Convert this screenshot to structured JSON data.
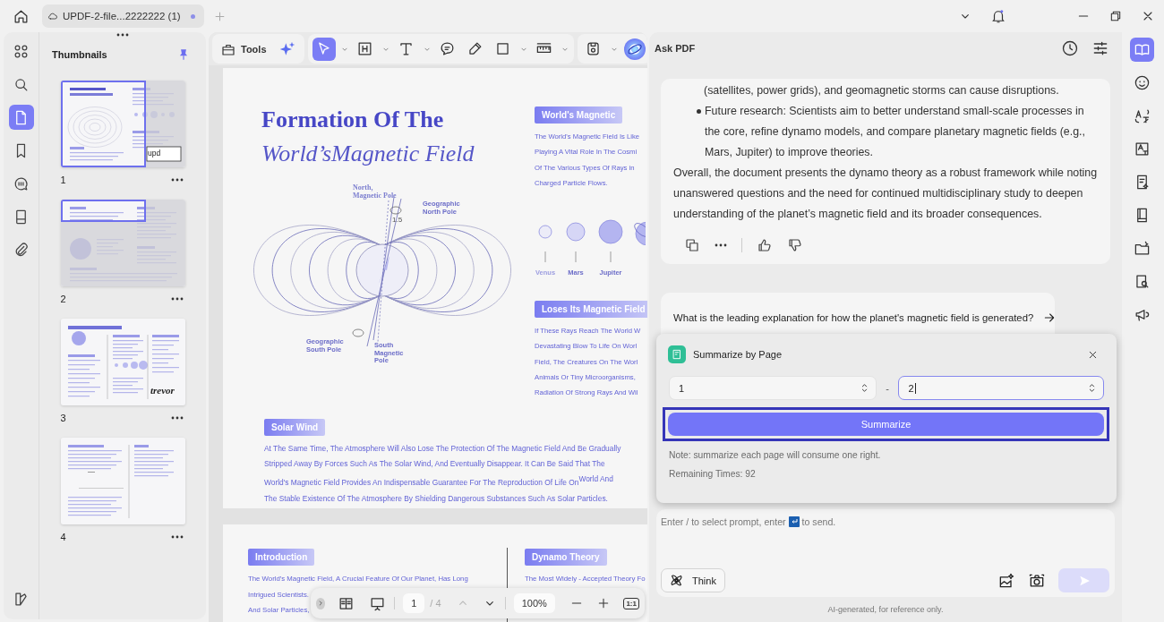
{
  "tab_bar": {
    "tabs": [
      {
        "title": "UPDF-2-file...2222222 (1)",
        "selected": true
      }
    ]
  },
  "left_rail": {
    "items": [
      {
        "selected": false
      },
      {
        "selected": false
      },
      {
        "selected": true
      },
      {
        "selected": false
      },
      {
        "selected": false
      },
      {
        "selected": false
      },
      {
        "selected": false
      },
      {
        "selected": false
      }
    ]
  },
  "thumbnails": {
    "title": "Thumbnails",
    "pages": [
      {
        "number": "1",
        "in_view": true,
        "mark_text": "upd"
      },
      {
        "number": "2",
        "in_view": true
      },
      {
        "number": "3",
        "in_view": false,
        "mark_text": "trevor"
      },
      {
        "number": "4",
        "in_view": false
      }
    ]
  },
  "toolbar": {
    "tools_label": "Tools",
    "tools": [
      {
        "selected": true,
        "menu": true
      },
      {
        "selected": false,
        "menu": true
      },
      {
        "selected": false,
        "menu": true
      },
      {
        "selected": false,
        "menu": false
      },
      {
        "selected": false,
        "menu": false
      },
      {
        "selected": false,
        "menu": true
      },
      {
        "selected": false,
        "menu": true
      }
    ],
    "file_tools": [
      {
        "selected": false,
        "menu": true
      }
    ]
  },
  "page_1": {
    "title": "Formation Of The",
    "subtitle": "World’sMagnetic Field",
    "diagram_labels": [
      {
        "lines": [
          "North,",
          "Magnetic Pole"
        ]
      },
      {
        "lines": [
          "Geographic",
          "North Pole"
        ]
      },
      {
        "lines": [
          "1.5"
        ]
      },
      {
        "lines": [
          "Geographic",
          "South Pole"
        ]
      },
      {
        "lines": [
          "South",
          "Magnetic",
          "Pole"
        ]
      }
    ],
    "sections": [
      {
        "heading": "World's Magnetic",
        "lines": [
          "The World's Magnetic Field Is Like",
          "Playing A Vital Role In The Cosmi",
          "Of The Various Types Of Rays in",
          "Charged Particle Flows."
        ]
      },
      {
        "heading": "Loses Its Magnetic Field",
        "lines": [
          "If These Rays Reach The World W",
          "Devastating Blow To Life On Worl",
          "Field, The Creatures On The Worl",
          "Animals Or Tiny Microorganisms,",
          "Radiation Of Strong Rays And Wil"
        ]
      }
    ],
    "planets": [
      {
        "name": "Venus"
      },
      {
        "name": "Mars"
      },
      {
        "name": "Jupiter"
      }
    ],
    "solar_wind": {
      "heading": "Solar Wind",
      "lines": [
        "At The Same Time, The Atmosphere Will Also Lose The Protection Of The Magnetic Field And Be Gradually",
        "Stripped Away By Forces Such As The Solar Wind, And Eventually Disappear. It Can Be Said That The",
        "World's Magnetic Field Provides An Indispensable Guarantee For The Reproduction Of Life On$^{World And}$",
        "The Stable Existence Of The Atmosphere By Shielding Dangerous Substances Such As Solar Particles."
      ]
    }
  },
  "page_2": {
    "left": {
      "heading": "Introduction",
      "lines": [
        "The World's Magnetic Field, A Crucial Feature Of Our Planet, Has Long",
        "Intrigued Scientists.",
        "And Solar Particles,"
      ]
    },
    "right": {
      "heading": "Dynamo Theory",
      "lines": [
        "The Most Widely - Accepted Theory Fo"
      ]
    }
  },
  "page_nav": {
    "page": "1",
    "total": "/ 4",
    "zoom": "100%",
    "actual_size": "1:1",
    "prev_disabled": true
  },
  "ask_pdf": {
    "title": "Ask PDF",
    "answer": {
      "continued": "(satellites, power grids), and geomagnetic storms can cause disruptions.",
      "bullets": [
        "Future research: Scientists aim to better understand small-scale processes in the core, refine dynamo models, and compare planetary magnetic fields (e.g., Mars, Jupiter) to improve theories."
      ],
      "summary": "Overall, the document presents the dynamo theory as a robust framework while noting unanswered questions and the need for continued multidisciplinary study to deepen understanding of the planet’s magnetic field and its broader consequences."
    },
    "suggestion": "What is the leading explanation for how the planet's magnetic field is generated?",
    "summarize": {
      "title": "Summarize by Page",
      "from": {
        "value": "1",
        "focused": false
      },
      "separator": "-",
      "to": {
        "value": "2",
        "focused": true
      },
      "button": "Summarize",
      "button_focused": true,
      "note": "Note: summarize each page will consume one right.",
      "remaining": "Remaining Times: 92"
    },
    "prompt": {
      "hint_before": "Enter / to select prompt, enter",
      "hint_after": "to send.",
      "think": "Think",
      "send_disabled": true
    },
    "disclaimer": "AI-generated, for reference only."
  },
  "right_rail": {
    "items": [
      {
        "selected": true
      },
      {
        "selected": false
      },
      {
        "selected": false
      },
      {
        "selected": false
      },
      {
        "selected": false
      },
      {
        "selected": false
      },
      {
        "selected": false
      },
      {
        "selected": false
      },
      {
        "selected": false
      }
    ]
  }
}
